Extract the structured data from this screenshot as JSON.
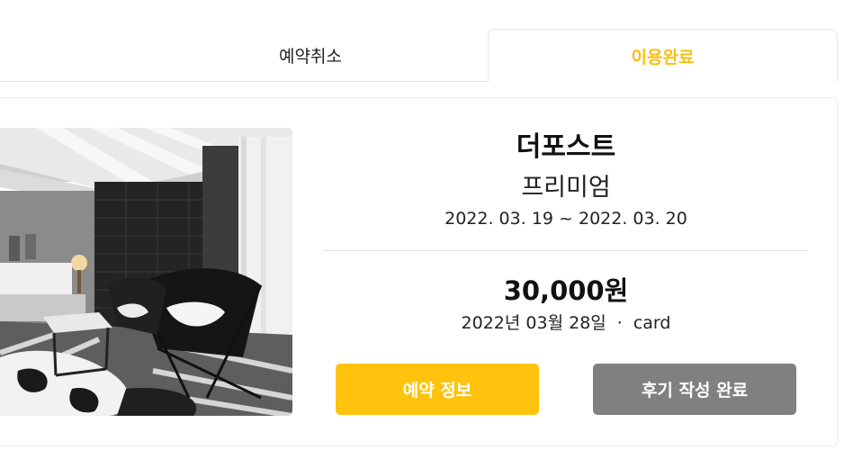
{
  "tabs": {
    "cancel_label": "예약취소",
    "done_label": "이용완료"
  },
  "booking": {
    "hotel_name": "더포스트",
    "room_type": "프리미엄",
    "date_range": "2022. 03. 19 ~ 2022. 03. 20",
    "price": "30,000원",
    "payment_date": "2022년 03월 28일",
    "separator": "·",
    "payment_method": "card"
  },
  "buttons": {
    "info_label": "예약 정보",
    "review_label": "후기 작성 완료"
  },
  "colors": {
    "accent": "#FBBF10",
    "button_primary": "#FFC30D",
    "button_disabled": "#808080"
  }
}
